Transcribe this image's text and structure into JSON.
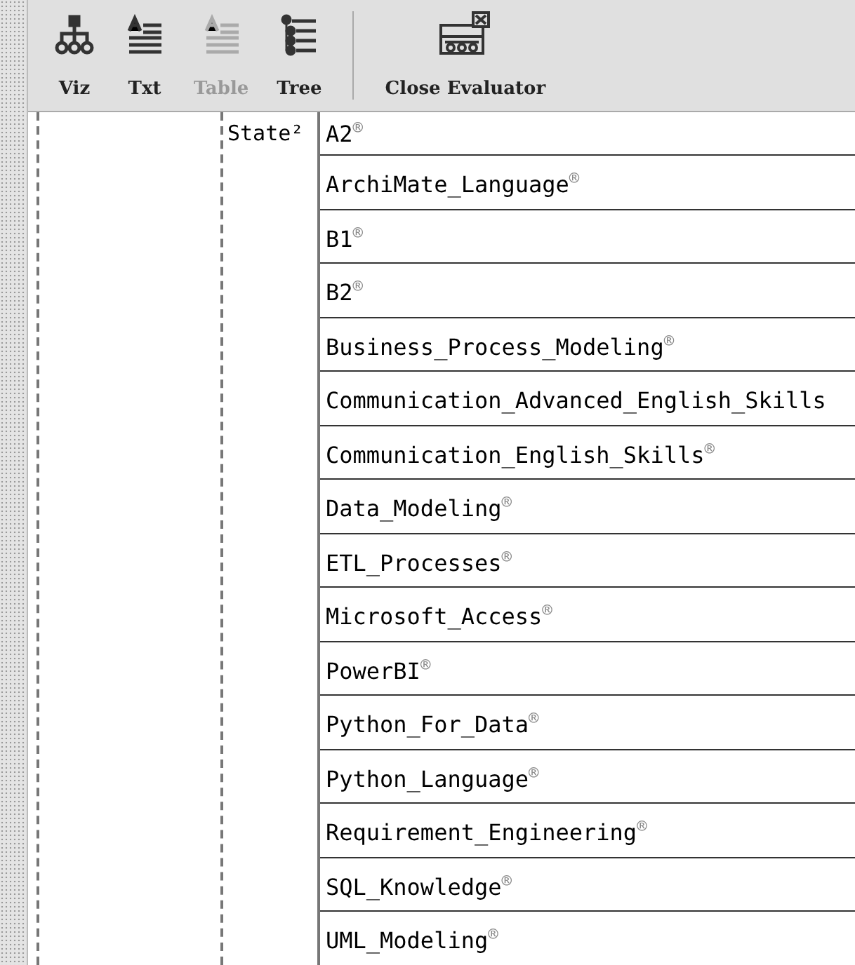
{
  "toolbar": {
    "buttons": [
      {
        "kind": "viz",
        "label": "Viz",
        "disabled": false
      },
      {
        "kind": "txt",
        "label": "Txt",
        "disabled": false
      },
      {
        "kind": "table",
        "label": "Table",
        "disabled": true
      },
      {
        "kind": "tree",
        "label": "Tree",
        "disabled": false
      },
      {
        "kind": "close",
        "label": "Close Evaluator",
        "disabled": false
      }
    ]
  },
  "table": {
    "column_2": "State²",
    "rows": [
      "A2$^{®}$",
      "ArchiMate_Language$^{®}$",
      "B1$^{®}$",
      "B2$^{®}$",
      "Business_Process_Modeling$^{®}$",
      "Communication_Advanced_English_Skills",
      "Communication_English_Skills$^{®}$",
      "Data_Modeling$^{®}$",
      "ETL_Processes$^{®}$",
      "Microsoft_Access$^{®}$",
      "PowerBI$^{®}$",
      "Python_For_Data$^{®}$",
      "Python_Language$^{®}$",
      "Requirement_Engineering$^{®}$",
      "SQL_Knowledge$^{®}$",
      "UML_Modeling$^{®}$"
    ]
  }
}
